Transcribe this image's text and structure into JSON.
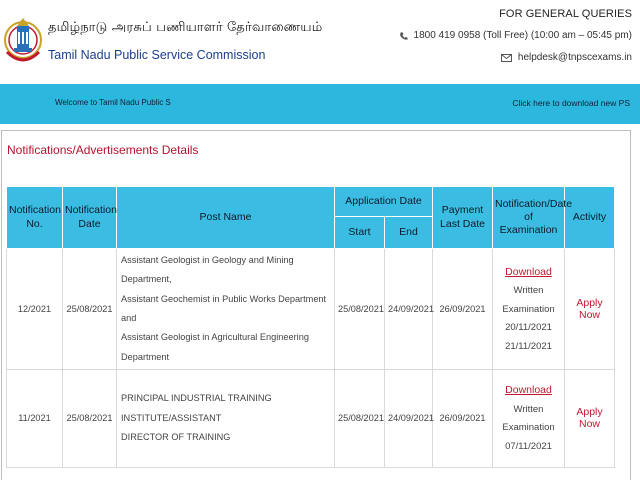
{
  "header": {
    "tamil_name": "தமிழ்நாடு அரசுப் பணியாளர் தேர்வாணையம்",
    "english_name": "Tamil Nadu Public Service Commission",
    "queries_title": "FOR GENERAL QUERIES",
    "phone": "1800 419 0958 (Toll Free) (10:00 am – 05:45 pm)",
    "email": "helpdesk@tnpscexams.in"
  },
  "ticker": {
    "left_text": "Welcome to Tamil Nadu Public S",
    "right_text": "Click here to download new PS"
  },
  "section_title": "Notifications/Advertisements Details",
  "table": {
    "headers": {
      "no": "Notification No.",
      "date": "Notification Date",
      "post": "Post Name",
      "app_date": "Application Date",
      "start": "Start",
      "end": "End",
      "payment": "Payment Last Date",
      "exam": "Notification/Date of Examination",
      "activity": "Activity"
    },
    "rows": [
      {
        "no": "12/2021",
        "date": "25/08/2021",
        "post_lines": [
          "Assistant Geologist in Geology and Mining Department,",
          "Assistant Geochemist in Public Works Department and",
          "Assistant Geologist in Agricultural Engineering",
          "Department"
        ],
        "start": "25/08/2021",
        "end": "24/09/2021",
        "payment": "26/09/2021",
        "download": "Download",
        "exam_lines": [
          "Written",
          "Examination",
          "20/11/2021",
          "21/11/2021"
        ],
        "apply": "Apply Now"
      },
      {
        "no": "11/2021",
        "date": "25/08/2021",
        "post_lines": [
          "PRINCIPAL INDUSTRIAL TRAINING INSTITUTE/ASSISTANT",
          "DIRECTOR OF TRAINING"
        ],
        "start": "25/08/2021",
        "end": "24/09/2021",
        "payment": "26/09/2021",
        "download": "Download",
        "exam_lines": [
          "Written",
          "Examination",
          "07/11/2021"
        ],
        "apply": "Apply Now"
      }
    ]
  },
  "colors": {
    "accent": "#2cb7de",
    "header_cell": "#3bbde3",
    "link_red": "#c0192f",
    "brand_blue": "#1c3f8e"
  },
  "icons": [
    "tnpsc-emblem-icon",
    "phone-icon",
    "mail-icon"
  ]
}
